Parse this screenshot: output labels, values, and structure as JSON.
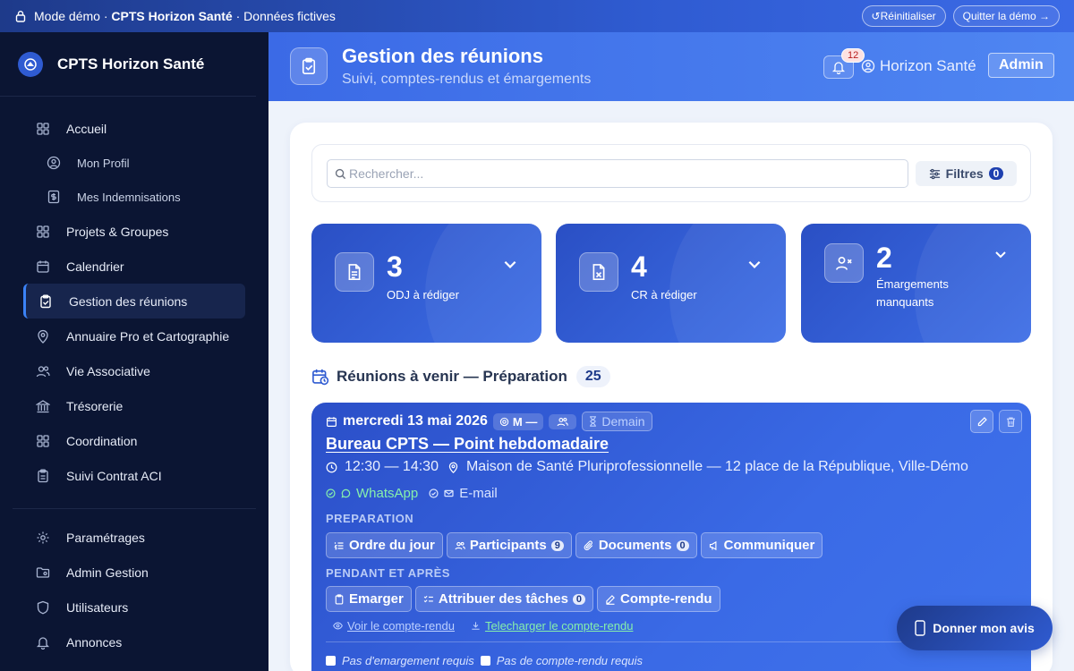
{
  "demo_bar": {
    "prefix": "Mode démo ·",
    "org": "CPTS Horizon Santé",
    "suffix": "· Données fictives",
    "reset_label": "↺Réinitialiser",
    "quit_label": "Quitter la démo →"
  },
  "sidebar": {
    "brand": "CPTS Horizon Santé",
    "items": [
      {
        "label": "Accueil",
        "icon": "grid-icon"
      },
      {
        "label": "Mon Profil",
        "icon": "user-circle-icon"
      },
      {
        "label": "Mes Indemnisations",
        "icon": "dollar-icon"
      },
      {
        "label": "Projets & Groupes",
        "icon": "grid-icon"
      },
      {
        "label": "Calendrier",
        "icon": "calendar-icon"
      },
      {
        "label": "Gestion des réunions",
        "icon": "clipboard-check-icon"
      },
      {
        "label": "Annuaire Pro et Cartographie",
        "icon": "map-pin-icon"
      },
      {
        "label": "Vie Associative",
        "icon": "users-icon"
      },
      {
        "label": "Trésorerie",
        "icon": "bank-icon"
      },
      {
        "label": "Coordination",
        "icon": "grid-icon"
      },
      {
        "label": "Suivi Contrat ACI",
        "icon": "clipboard-icon"
      }
    ],
    "bottom_items": [
      {
        "label": "Paramétrages",
        "icon": "gear-icon"
      },
      {
        "label": "Admin Gestion",
        "icon": "folder-gear-icon"
      },
      {
        "label": "Utilisateurs",
        "icon": "shield-icon"
      },
      {
        "label": "Annonces",
        "icon": "bell-icon"
      }
    ]
  },
  "header": {
    "title": "Gestion des réunions",
    "subtitle": "Suivi, comptes-rendus et émargements",
    "notif_count": "12",
    "org": "Horizon Santé",
    "admin_label": "Admin"
  },
  "search": {
    "placeholder": "Rechercher...",
    "filters_label": "Filtres",
    "filters_count": "0"
  },
  "stats": [
    {
      "value": "3",
      "label": "ODJ à rédiger"
    },
    {
      "value": "4",
      "label": "CR à rédiger"
    },
    {
      "value": "2",
      "label": "Émargements manquants"
    }
  ],
  "section": {
    "title": "Réunions à venir — Préparation",
    "count": "25"
  },
  "meeting": {
    "date": "mercredi 13 mai 2026",
    "mode_tag": "M —",
    "when_tag": "Demain",
    "title": "Bureau CPTS — Point hebdomadaire",
    "time": "12:30 — 14:30",
    "location": "Maison de Santé Pluriprofessionnelle — 12 place de la République, Ville-Démo",
    "channel_whatsapp": "WhatsApp",
    "channel_email": "E-mail",
    "prep_label": "PREPARATION",
    "prep_buttons": {
      "odj": "Ordre du jour",
      "participants": "Participants",
      "participants_count": "9",
      "documents": "Documents",
      "documents_count": "0",
      "communiquer": "Communiquer"
    },
    "during_label": "PENDANT ET APRÈS",
    "during_buttons": {
      "emarger": "Emarger",
      "taches": "Attribuer des tâches",
      "taches_count": "0",
      "cr": "Compte-rendu"
    },
    "link_view": "Voir le compte-rendu",
    "link_download": "Telecharger le compte-rendu",
    "check_1": "Pas d'emargement requis",
    "check_2": "Pas de compte-rendu requis"
  },
  "feedback_label": "Donner mon avis",
  "colors": {
    "sidebar_bg": "#0b1533",
    "accent": "#3b6ae6",
    "card": "#2f5bd1"
  }
}
